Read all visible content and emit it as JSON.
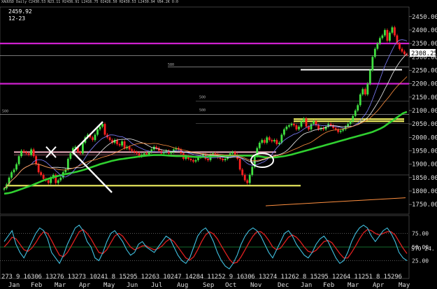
{
  "header": {
    "info": "XAUUSD Daily C2430.53 N23.11 H2436.91 L2416.75 O2426.50 H2430.53 L2430.94 V84.2K O:0",
    "last_price": "2459.92",
    "last_date": "12-23"
  },
  "price_axis": {
    "ticks": [
      "2450.00",
      "2400.00",
      "2350.00",
      "2300.00",
      "2250.00",
      "2200.00",
      "2150.00",
      "2100.00",
      "2050.00",
      "2000.00",
      "1950.00",
      "1900.00",
      "1850.00",
      "1800.00",
      "1750.00"
    ],
    "current": "2308.25"
  },
  "date_axis": {
    "days": [
      "27",
      "3",
      "9",
      "16",
      "30",
      "6",
      "13",
      "27",
      "6",
      "13",
      "27",
      "3",
      "10",
      "24",
      "1",
      "8",
      "15",
      "29",
      "5",
      "12",
      "26",
      "3",
      "10",
      "24",
      "7",
      "14",
      "28",
      "4",
      "11",
      "25",
      "2",
      "9",
      "16",
      "30",
      "6",
      "13",
      "27",
      "4",
      "11",
      "26",
      "2",
      "8",
      "15",
      "29",
      "5",
      "12",
      "26",
      "4",
      "11",
      "25",
      "1",
      "8",
      "15",
      "29",
      "6"
    ],
    "months": [
      "Jan",
      "Feb",
      "Mar",
      "Apr",
      "May",
      "Jun",
      "Jul",
      "Aug",
      "Sep",
      "Oct",
      "Nov",
      "Dec",
      "Jan",
      "Feb",
      "Mar",
      "Apr",
      "May"
    ]
  },
  "level_labels": [
    "580",
    "500",
    "500",
    "500"
  ],
  "oscillator": {
    "label": "STO 24.",
    "ticks": [
      "75.00",
      "50.00",
      "25.00"
    ]
  },
  "chart_data": {
    "type": "candlestick",
    "title": "",
    "ylim": [
      1740,
      2465
    ],
    "close": [
      1810,
      1825,
      1850,
      1870,
      1880,
      1900,
      1930,
      1950,
      1945,
      1940,
      1935,
      1955,
      1930,
      1900,
      1870,
      1860,
      1845,
      1840,
      1830,
      1850,
      1860,
      1830,
      1840,
      1850,
      1870,
      1880,
      1920,
      1940,
      1960,
      1965,
      1945,
      1940,
      1980,
      2000,
      2010,
      2000,
      1990,
      2010,
      2030,
      2040,
      2050,
      2010,
      2000,
      1990,
      1980,
      1990,
      1975,
      1970,
      1985,
      1960,
      1965,
      1955,
      1950,
      1945,
      1940,
      1930,
      1935,
      1940,
      1935,
      1945,
      1955,
      1965,
      1960,
      1950,
      1940,
      1945,
      1950,
      1940,
      1945,
      1955,
      1960,
      1955,
      1940,
      1920,
      1930,
      1920,
      1915,
      1910,
      1915,
      1925,
      1930,
      1935,
      1920,
      1915,
      1935,
      1940,
      1935,
      1925,
      1920,
      1915,
      1920,
      1930,
      1940,
      1945,
      1935,
      1920,
      1880,
      1860,
      1840,
      1830,
      1860,
      1890,
      1930,
      1960,
      1980,
      1990,
      1980,
      2000,
      1990,
      1985,
      1990,
      1975,
      1980,
      2010,
      2030,
      2040,
      2045,
      2050,
      2045,
      2030,
      2040,
      2060,
      2070,
      2040,
      2030,
      2050,
      2060,
      2045,
      2030,
      2035,
      2030,
      2040,
      2050,
      2045,
      2035,
      2030,
      2020,
      2025,
      2030,
      2040,
      2050,
      2060,
      2080,
      2100,
      2120,
      2160,
      2180,
      2160,
      2200,
      2250,
      2300,
      2330,
      2350,
      2370,
      2380,
      2400,
      2360,
      2390,
      2410,
      2380,
      2350,
      2330,
      2320,
      2310,
      2308
    ],
    "ma_green": [
      1790,
      1792,
      1795,
      1800,
      1805,
      1810,
      1815,
      1820,
      1826,
      1832,
      1838,
      1843,
      1848,
      1852,
      1856,
      1860,
      1863,
      1866,
      1869,
      1872,
      1876,
      1880,
      1885,
      1890,
      1895,
      1900,
      1904,
      1908,
      1912,
      1915,
      1918,
      1920,
      1922,
      1924,
      1926,
      1928,
      1930,
      1932,
      1933,
      1934,
      1934,
      1934,
      1933,
      1932,
      1931,
      1930,
      1930,
      1930,
      1929,
      1928,
      1927,
      1927,
      1927,
      1928,
      1929,
      1930,
      1930,
      1931,
      1931,
      1932,
      1932,
      1932,
      1932,
      1932,
      1932,
      1931,
      1930,
      1928,
      1926,
      1925,
      1925,
      1926,
      1928,
      1930,
      1933,
      1936,
      1940,
      1944,
      1948,
      1952,
      1956,
      1960,
      1964,
      1968,
      1972,
      1976,
      1980,
      1984,
      1988,
      1992,
      1996,
      2000,
      2004,
      2008,
      2012,
      2016,
      2020,
      2026,
      2032,
      2040,
      2050,
      2060,
      2070,
      2080,
      2090,
      2095
    ],
    "pink_line_y": 1945,
    "yellow_lines_y": [
      1820,
      2068,
      2060
    ],
    "magenta_lines_y": [
      2350,
      2200
    ],
    "white_lines_y": [
      2262,
      2248
    ],
    "stochastic": {
      "k": [
        60,
        70,
        80,
        55,
        40,
        30,
        45,
        60,
        75,
        85,
        80,
        65,
        40,
        30,
        20,
        35,
        55,
        70,
        85,
        90,
        80,
        60,
        50,
        30,
        25,
        40,
        60,
        75,
        80,
        70,
        60,
        45,
        35,
        40,
        55,
        60,
        50,
        45,
        40,
        50,
        60,
        70,
        65,
        50,
        35,
        25,
        20,
        30,
        50,
        70,
        80,
        85,
        75,
        60,
        40,
        25,
        15,
        10,
        20,
        35,
        55,
        70,
        80,
        85,
        80,
        70,
        55,
        40,
        30,
        45,
        60,
        75,
        80,
        70,
        55,
        45,
        35,
        30,
        40,
        55,
        65,
        70,
        60,
        45,
        30,
        20,
        25,
        40,
        60,
        75,
        85,
        90,
        85,
        70,
        60,
        70,
        80,
        85,
        75,
        60,
        40,
        30,
        25
      ],
      "d": [
        50,
        58,
        68,
        65,
        55,
        45,
        42,
        48,
        58,
        70,
        78,
        75,
        62,
        48,
        35,
        32,
        40,
        52,
        65,
        78,
        82,
        75,
        65,
        52,
        40,
        38,
        45,
        58,
        70,
        75,
        70,
        60,
        50,
        45,
        48,
        52,
        52,
        48,
        45,
        47,
        52,
        60,
        65,
        60,
        50,
        40,
        30,
        26,
        32,
        45,
        60,
        72,
        78,
        74,
        65,
        52,
        40,
        28,
        20,
        22,
        32,
        45,
        58,
        70,
        78,
        78,
        72,
        62,
        50,
        45,
        48,
        58,
        68,
        72,
        68,
        60,
        50,
        42,
        40,
        44,
        52,
        60,
        62,
        58,
        48,
        38,
        30,
        30,
        40,
        52,
        65,
        76,
        82,
        80,
        75,
        72,
        75,
        78,
        78,
        72,
        60,
        48,
        38
      ]
    }
  }
}
